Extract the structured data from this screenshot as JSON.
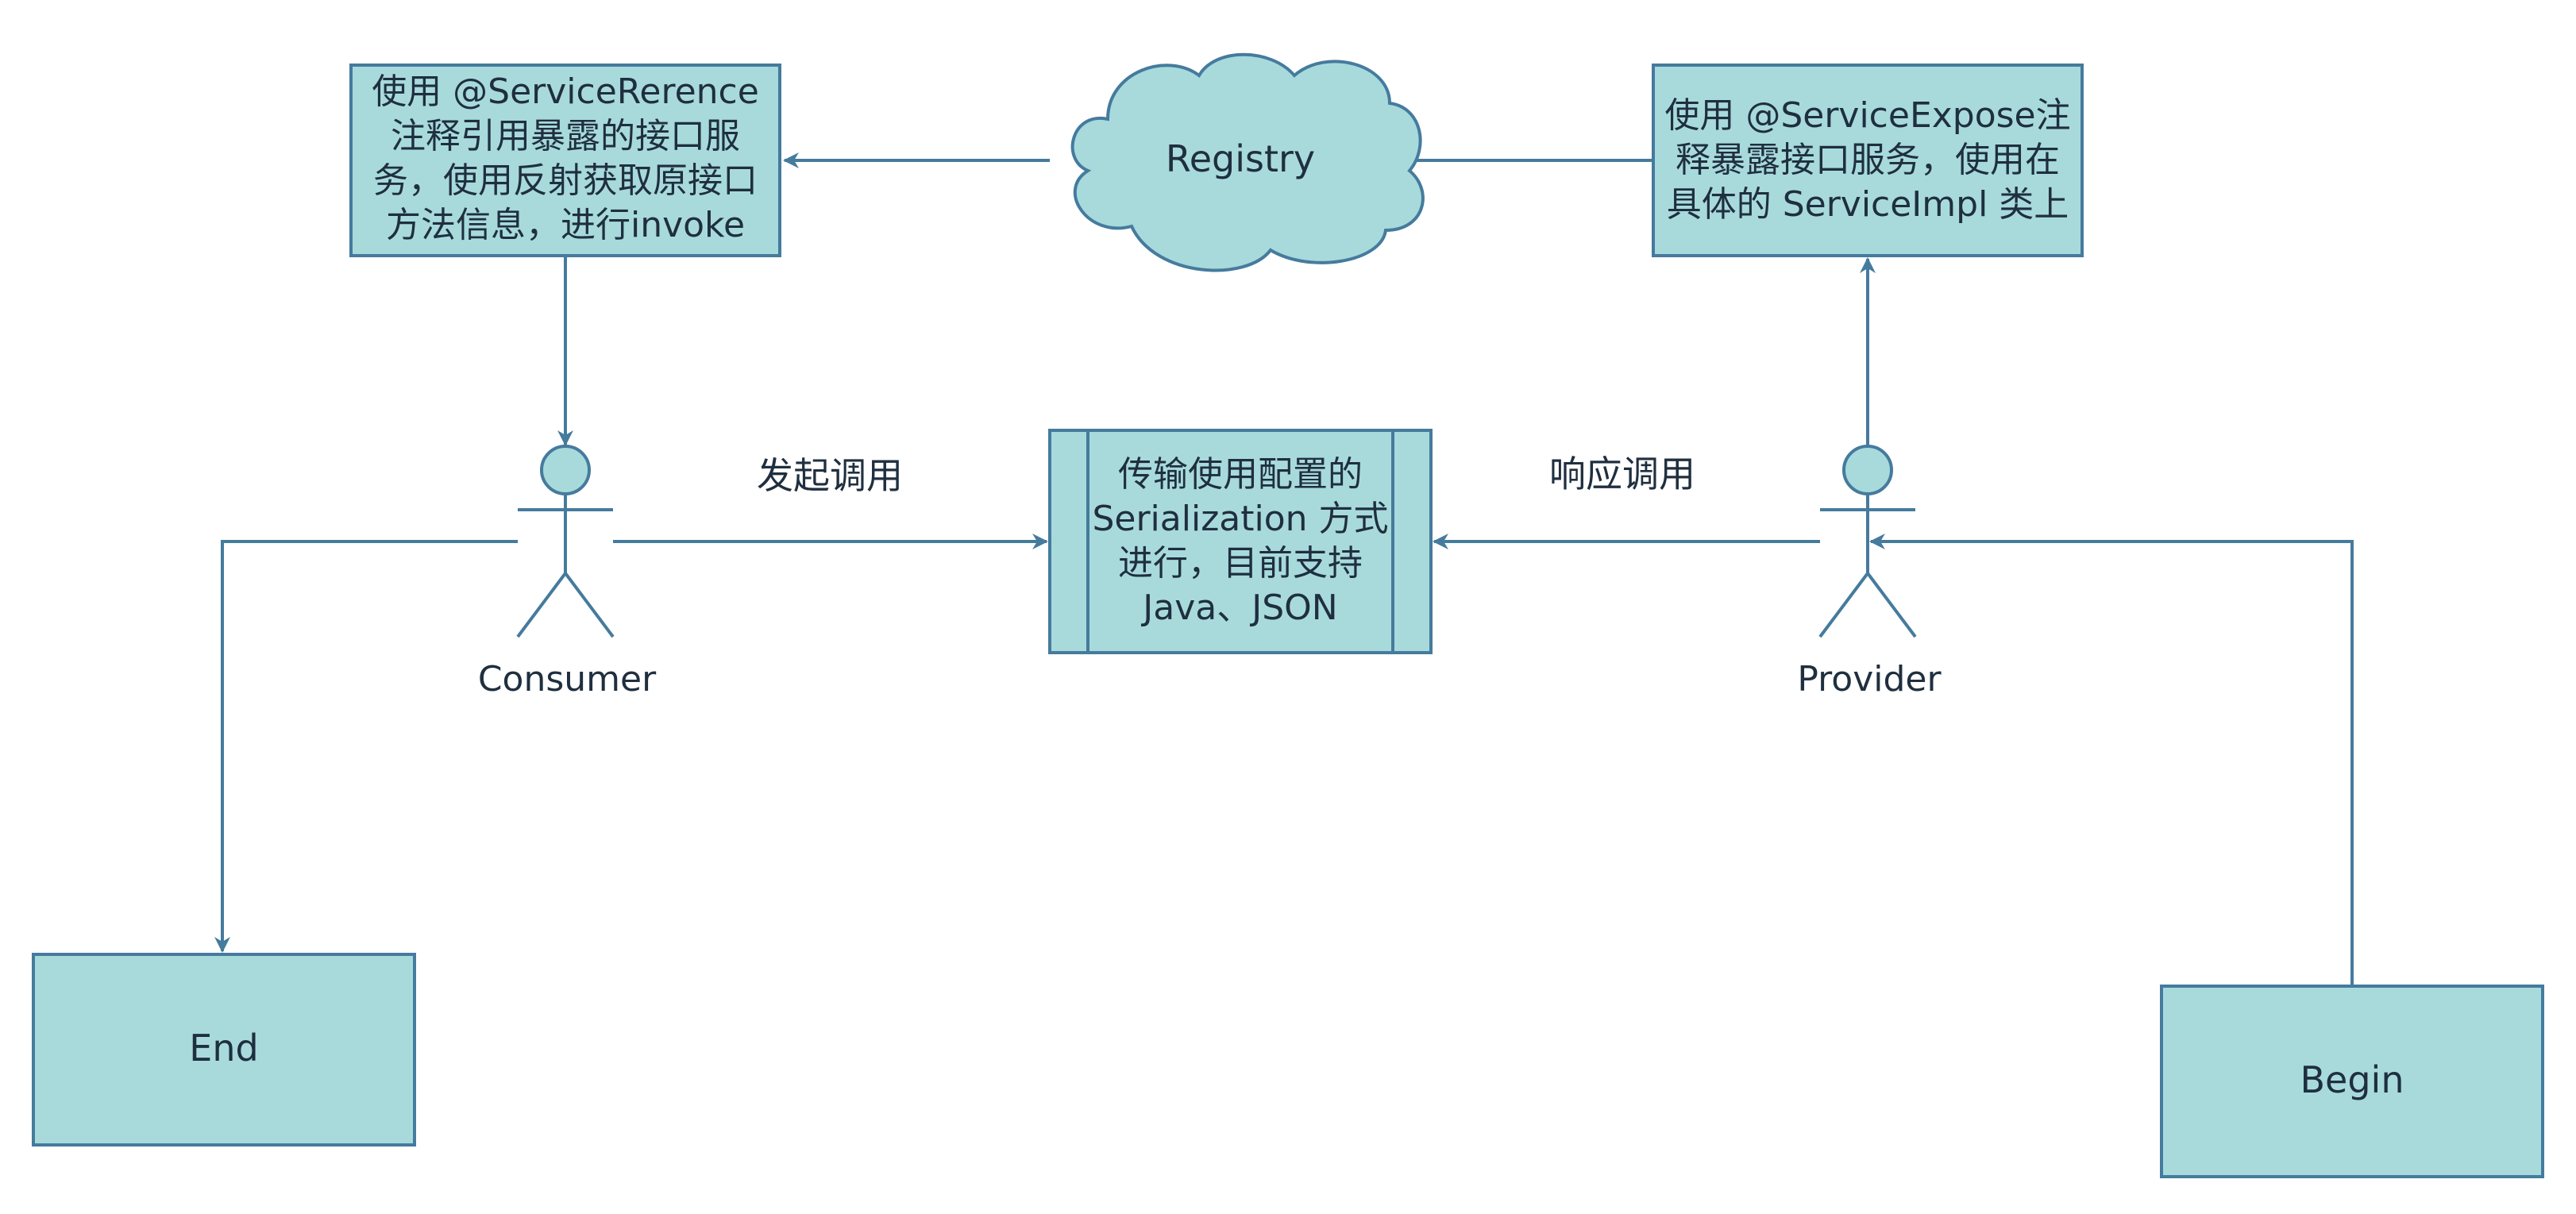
{
  "colors": {
    "fill": "#a8dadc",
    "stroke": "#457b9d",
    "text": "#1f2f3f",
    "background": "#ffffff"
  },
  "nodes": {
    "reference_box": {
      "lines": [
        "使用 @ServiceRerence",
        "注释引用暴露的接口服",
        "务，使用反射获取原接口",
        "方法信息，进行invoke"
      ]
    },
    "registry": {
      "label": "Registry"
    },
    "expose_box": {
      "lines": [
        "使用 @ServiceExpose注",
        "释暴露接口服务，使用在",
        "具体的 ServiceImpl 类上"
      ]
    },
    "consumer": {
      "label": "Consumer"
    },
    "provider": {
      "label": "Provider"
    },
    "serialization_box": {
      "lines": [
        "传输使用配置的",
        "Serialization 方式",
        "进行，目前支持",
        "Java、JSON"
      ]
    },
    "end_box": {
      "label": "End"
    },
    "begin_box": {
      "label": "Begin"
    }
  },
  "edges": {
    "invoke_label": "发起调用",
    "response_label": "响应调用"
  }
}
